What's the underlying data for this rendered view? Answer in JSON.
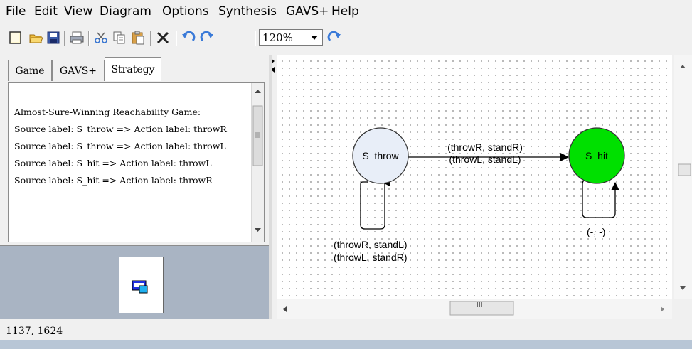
{
  "menu": [
    "File",
    "Edit",
    "View",
    "Diagram",
    "Options",
    "Synthesis",
    "GAVS+",
    "Help"
  ],
  "toolbar": {
    "icons": [
      "new-file-icon",
      "open-folder-icon",
      "save-icon",
      "print-icon",
      "cut-icon",
      "copy-icon",
      "paste-icon",
      "delete-icon",
      "undo-icon",
      "redo-icon",
      "refresh-icon"
    ],
    "zoom": "120%"
  },
  "tabs": {
    "game": "Game",
    "gavs": "GAVS+",
    "strategy": "Strategy",
    "active": "Strategy"
  },
  "strategy_text": [
    "-----------------------",
    "Almost-Sure-Winning Reachability Game:",
    "Source label: S_throw => Action label: throwR",
    "Source label: S_throw => Action label: throwL",
    "Source label: S_hit => Action label: throwL",
    "Source label: S_hit => Action label: throwR"
  ],
  "diagram": {
    "nodes": {
      "s_throw": {
        "label": "S_throw",
        "fill": "#e8eef8"
      },
      "s_hit": {
        "label": "S_hit",
        "fill": "#00e000"
      }
    },
    "edge_labels": {
      "throw_to_hit_1": "(throwR, standR)",
      "throw_to_hit_2": "(throwL, standL)",
      "throw_self_1": "(throwR, standL)",
      "throw_self_2": "(throwL, standR)",
      "hit_self": "(-, -)"
    }
  },
  "scrollbar": {
    "grip": "III"
  },
  "status": {
    "coords": "1137, 1624"
  }
}
